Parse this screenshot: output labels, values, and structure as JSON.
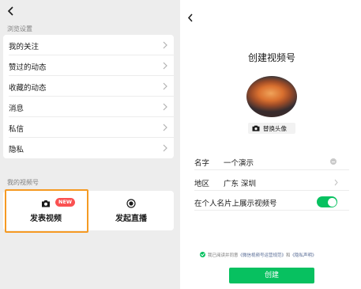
{
  "left_panel": {
    "section1_label": "浏览设置",
    "menu_items": [
      {
        "label": "我的关注"
      },
      {
        "label": "赞过的动态"
      },
      {
        "label": "收藏的动态"
      },
      {
        "label": "消息"
      },
      {
        "label": "私信"
      },
      {
        "label": "隐私"
      }
    ],
    "section2_label": "我的视频号",
    "actions": [
      {
        "label": "发表视频",
        "badge": "NEW",
        "icon": "camera-icon"
      },
      {
        "label": "发起直播",
        "icon": "live-icon"
      }
    ],
    "highlight_color": "#f59a23"
  },
  "right_panel": {
    "title": "创建视频号",
    "change_avatar_label": "替换头像",
    "form": {
      "name_label": "名字",
      "name_value": "一个演示",
      "region_label": "地区",
      "region_value": "广东 深圳",
      "show_card_label": "在个人名片上展示视频号",
      "show_card_on": true
    },
    "agreement": {
      "prefix": "我已阅读并同意",
      "link1": "《微信视频号运营规范》",
      "conj": "和",
      "link2": "《隐私声明》"
    },
    "create_button": "创建"
  },
  "colors": {
    "accent_green": "#07c160",
    "badge_red": "#fa5151",
    "background_gray": "#ededed"
  }
}
